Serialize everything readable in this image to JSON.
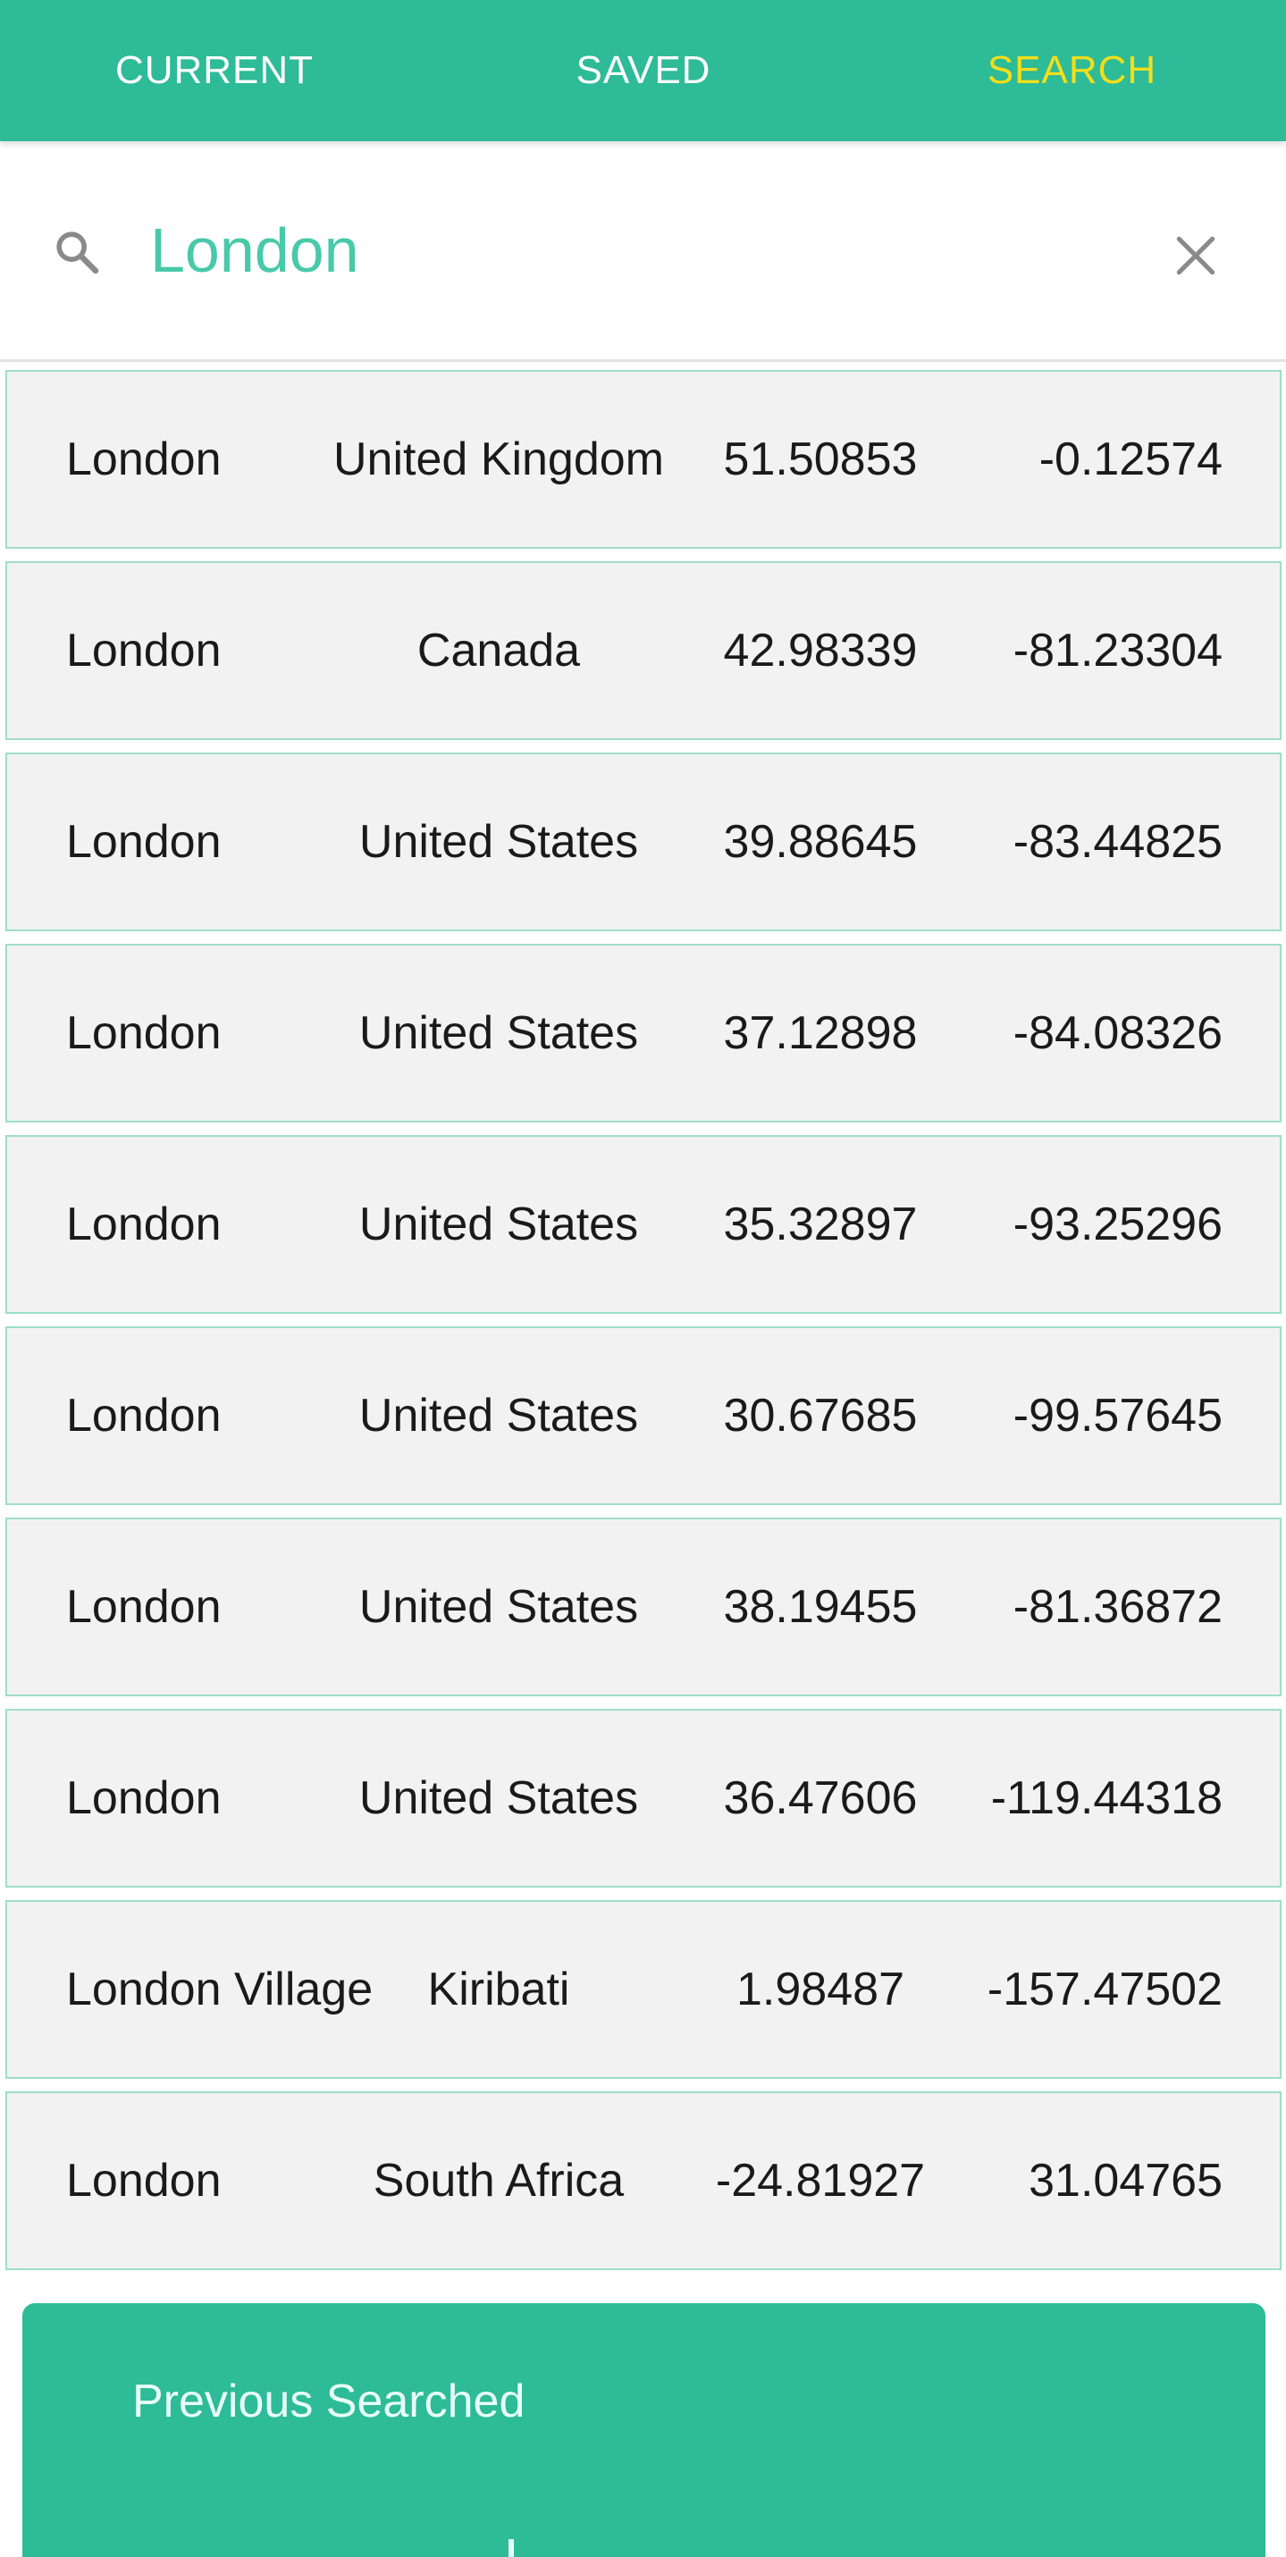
{
  "tabs": [
    {
      "label": "CURRENT"
    },
    {
      "label": "SAVED"
    },
    {
      "label": "SEARCH"
    }
  ],
  "search": {
    "value": "London",
    "icon": "search-icon",
    "clear_icon": "close-icon"
  },
  "results": [
    {
      "city": "London",
      "country": "United Kingdom",
      "lat": "51.50853",
      "lon": "-0.12574"
    },
    {
      "city": "London",
      "country": "Canada",
      "lat": "42.98339",
      "lon": "-81.23304"
    },
    {
      "city": "London",
      "country": "United States",
      "lat": "39.88645",
      "lon": "-83.44825"
    },
    {
      "city": "London",
      "country": "United States",
      "lat": "37.12898",
      "lon": "-84.08326"
    },
    {
      "city": "London",
      "country": "United States",
      "lat": "35.32897",
      "lon": "-93.25296"
    },
    {
      "city": "London",
      "country": "United States",
      "lat": "30.67685",
      "lon": "-99.57645"
    },
    {
      "city": "London",
      "country": "United States",
      "lat": "38.19455",
      "lon": "-81.36872"
    },
    {
      "city": "London",
      "country": "United States",
      "lat": "36.47606",
      "lon": "-119.44318"
    },
    {
      "city": "London Village",
      "country": "Kiribati",
      "lat": "1.98487",
      "lon": "-157.47502"
    },
    {
      "city": "London",
      "country": "South Africa",
      "lat": "-24.81927",
      "lon": "31.04765"
    }
  ],
  "previous": {
    "title": "Previous Searched"
  },
  "colors": {
    "primary": "#2EBB97",
    "active_tab": "#F2DE1B",
    "search_text": "#48C9A9",
    "row_bg": "#F2F2F2",
    "row_border": "#9FDDC9"
  }
}
